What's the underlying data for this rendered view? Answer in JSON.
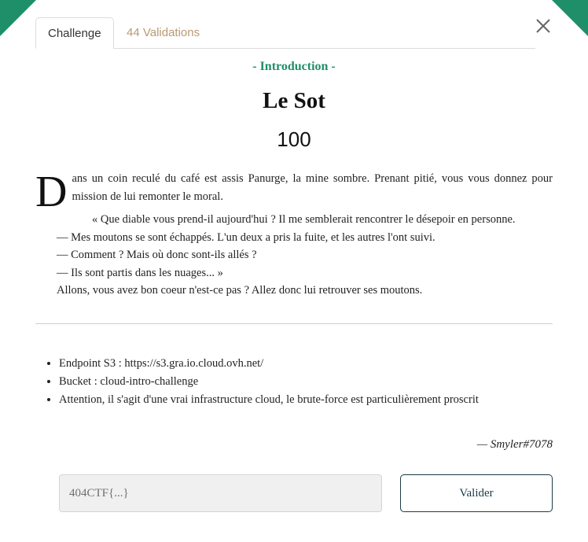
{
  "tabs": {
    "challenge": "Challenge",
    "validations": "44 Validations"
  },
  "challenge": {
    "category": "- Introduction -",
    "name": "Le Sot",
    "points": "100"
  },
  "description": {
    "dropcap": "D",
    "first_rest": "ans un coin reculé du café est assis Panurge, la mine sombre. Prenant pitié, vous vous donnez pour mission de lui remonter le moral.",
    "quote": "« Que diable vous prend-il aujourd'hui ? Il me semblerait rencontrer le désepoir en personne.",
    "line1": "— Mes moutons se sont échappés. L'un deux a pris la fuite, et les autres l'ont suivi.",
    "line2": "— Comment ? Mais où donc sont-ils allés ?",
    "line3": "— Ils sont partis dans les nuages... »",
    "line4": "Allons, vous avez bon coeur n'est-ce pas ? Allez donc lui retrouver ses moutons."
  },
  "hints": [
    "Endpoint S3 : https://s3.gra.io.cloud.ovh.net/",
    "Bucket : cloud-intro-challenge",
    "Attention, il s'agit d'une vrai infrastructure cloud, le brute-force est particulièrement proscrit"
  ],
  "author": "— Smyler#7078",
  "form": {
    "placeholder": "404CTF{...}",
    "submit_label": "Valider"
  },
  "colors": {
    "accent": "#1f8f6a",
    "tab_inactive": "#b89a72",
    "button_border": "#1b3b47"
  },
  "icons": {
    "close": "close-icon"
  }
}
